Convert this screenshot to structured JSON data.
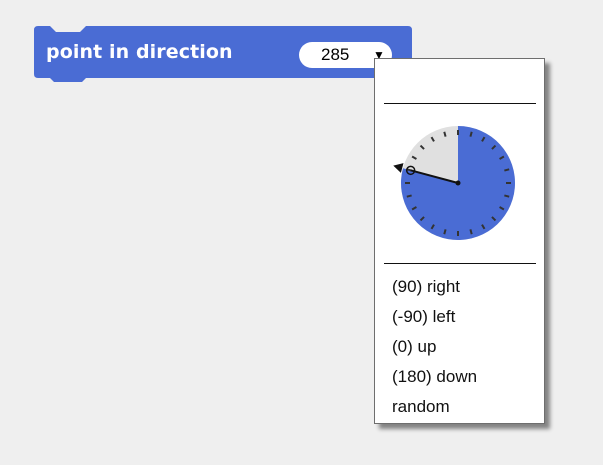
{
  "block": {
    "label": "point in direction",
    "value": "285",
    "color": "#4a6cd4",
    "dropdown_icon": "caret-down-icon"
  },
  "menu": {
    "dial": {
      "direction_degrees": 285,
      "fill_color": "#4a6cd4",
      "track_color": "#e0e0e0"
    },
    "items": [
      {
        "label": "(90) right"
      },
      {
        "label": "(-90) left"
      },
      {
        "label": "(0) up"
      },
      {
        "label": "(180) down"
      },
      {
        "label": "random"
      }
    ]
  }
}
